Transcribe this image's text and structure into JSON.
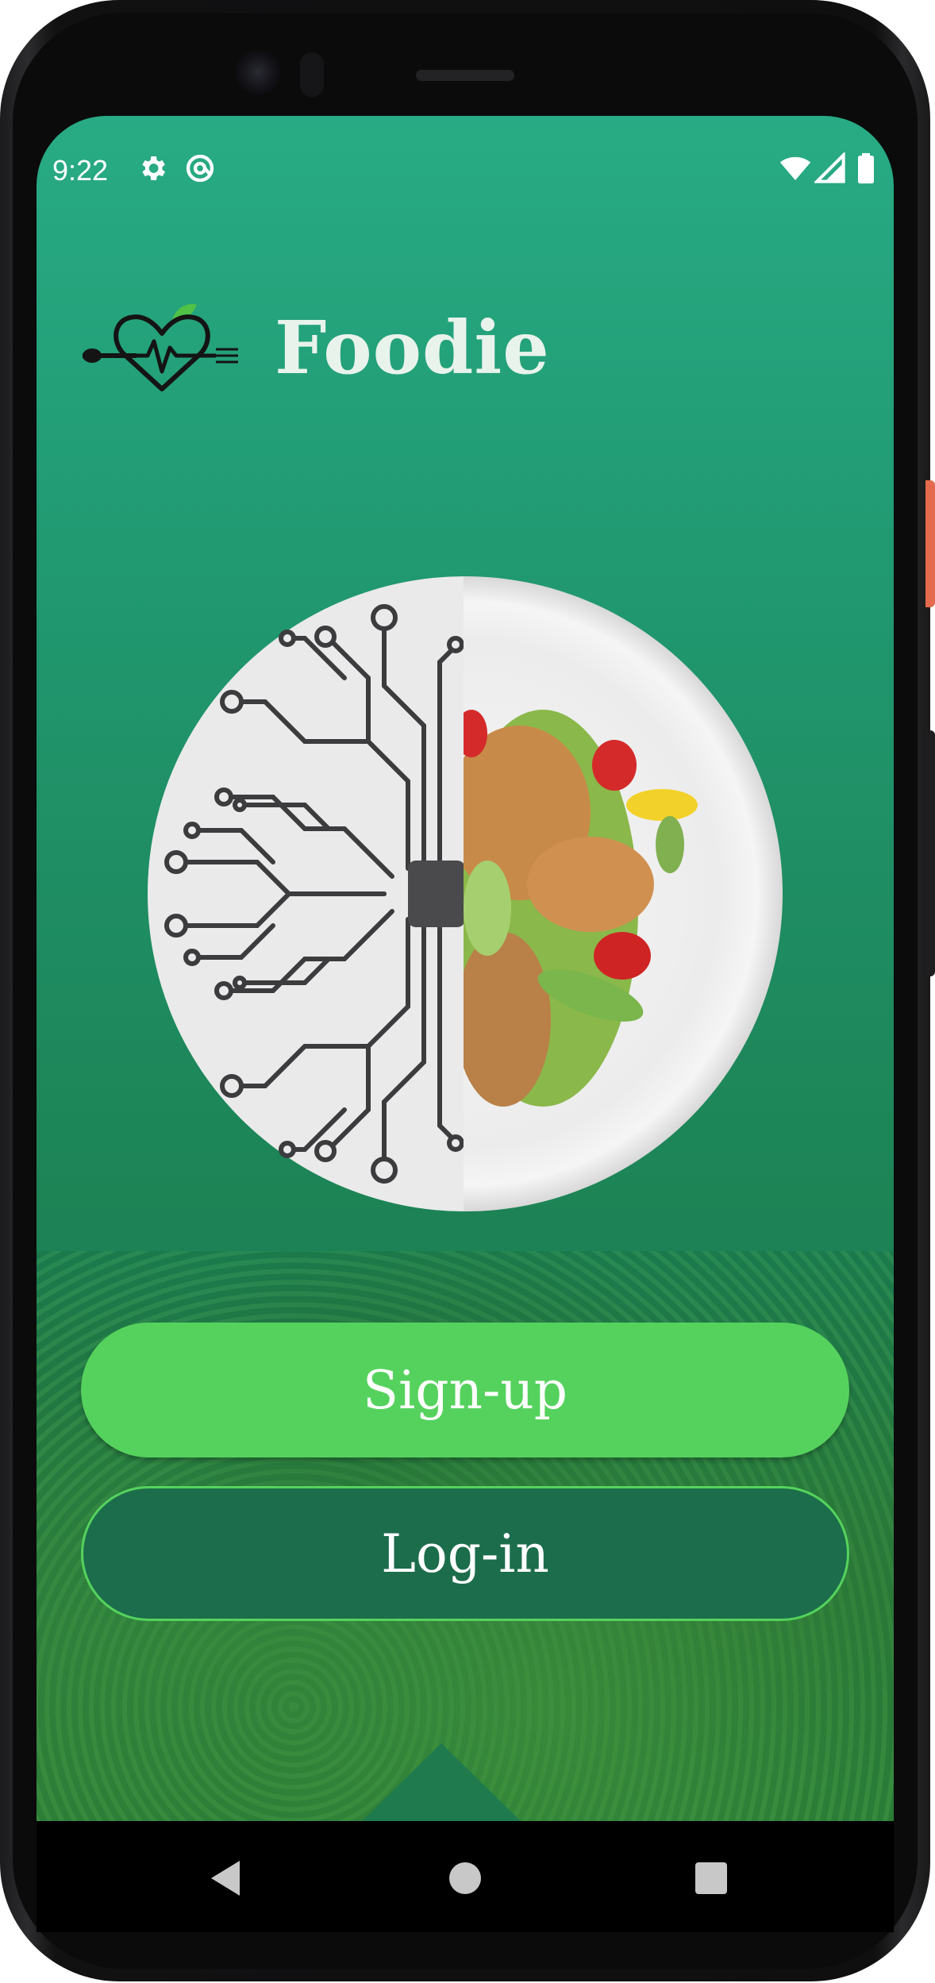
{
  "status_bar": {
    "time": "9:22",
    "left_icons": [
      "settings-icon",
      "at-sync-icon"
    ],
    "right_icons": [
      "wifi-icon",
      "cell-signal-icon",
      "battery-icon"
    ]
  },
  "header": {
    "app_name": "Foodie",
    "logo_icon": "heart-pulse-cutlery-logo"
  },
  "hero": {
    "image": "circuit-brain-salad-plate"
  },
  "actions": {
    "signup_label": "Sign-up",
    "login_label": "Log-in"
  },
  "nav_bar": {
    "icons": [
      "back-icon",
      "home-icon",
      "recents-icon"
    ]
  },
  "colors": {
    "background_top": "#28ab84",
    "background_bottom": "#1a6f46",
    "signup_button": "#55d25d",
    "login_button": "#1c6d4b",
    "title_text": "#e8f3ec"
  }
}
